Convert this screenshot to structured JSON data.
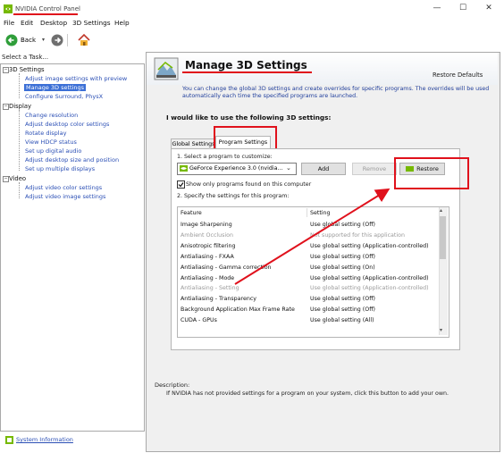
{
  "window": {
    "title": "NVIDIA Control Panel",
    "minimize": "—",
    "maximize": "☐",
    "close": "✕"
  },
  "menu": {
    "items": [
      "File",
      "Edit",
      "Desktop",
      "3D Settings",
      "Help"
    ]
  },
  "toolbar": {
    "back_label": "Back"
  },
  "left": {
    "task_header": "Select a Task...",
    "tree": [
      {
        "category": "3D Settings",
        "items": [
          "Adjust image settings with preview",
          "Manage 3D settings",
          "Configure Surround, PhysX"
        ]
      },
      {
        "category": "Display",
        "items": [
          "Change resolution",
          "Adjust desktop color settings",
          "Rotate display",
          "View HDCP status",
          "Set up digital audio",
          "Adjust desktop size and position",
          "Set up multiple displays"
        ]
      },
      {
        "category": "Video",
        "items": [
          "Adjust video color settings",
          "Adjust video image settings"
        ]
      }
    ],
    "selected_item": "Manage 3D settings",
    "system_info": "System Information"
  },
  "main": {
    "title": "Manage 3D Settings",
    "restore_defaults": "Restore Defaults",
    "intro": "You can change the global 3D settings and create overrides for specific programs. The overrides will be used automatically each time the specified programs are launched.",
    "section_title": "I would like to use the following 3D settings:",
    "tabs": [
      "Global Settings",
      "Program Settings"
    ],
    "active_tab": "Program Settings",
    "step1": "1. Select a program to customize:",
    "program_selected": "GeForce Experience 3.0 (nvidia...",
    "add_button": "Add",
    "remove_button": "Remove",
    "restore_button": "Restore",
    "show_only_checkbox": "Show only programs found on this computer",
    "step2": "2. Specify the settings for this program:",
    "columns": [
      "Feature",
      "Setting"
    ],
    "rows": [
      {
        "feature": "Image Sharpening",
        "setting": "Use global setting (Off)",
        "dim": false
      },
      {
        "feature": "Ambient Occlusion",
        "setting": "Not supported for this application",
        "dim": true
      },
      {
        "feature": "Anisotropic filtering",
        "setting": "Use global setting (Application-controlled)",
        "dim": false
      },
      {
        "feature": "Antialiasing - FXAA",
        "setting": "Use global setting (Off)",
        "dim": false
      },
      {
        "feature": "Antialiasing - Gamma correction",
        "setting": "Use global setting (On)",
        "dim": false
      },
      {
        "feature": "Antialiasing - Mode",
        "setting": "Use global setting (Application-controlled)",
        "dim": false
      },
      {
        "feature": "Antialiasing - Setting",
        "setting": "Use global setting (Application-controlled)",
        "dim": true
      },
      {
        "feature": "Antialiasing - Transparency",
        "setting": "Use global setting (Off)",
        "dim": false
      },
      {
        "feature": "Background Application Max Frame Rate",
        "setting": "Use global setting (Off)",
        "dim": false
      },
      {
        "feature": "CUDA - GPUs",
        "setting": "Use global setting (All)",
        "dim": false
      }
    ],
    "description_label": "Description:",
    "description_text": "If NVIDIA has not provided settings for a program on your system, click this button to add your own."
  },
  "colors": {
    "annotation_red": "#e0111c",
    "nvidia_green": "#76b900",
    "link_blue": "#2b4fb5"
  }
}
